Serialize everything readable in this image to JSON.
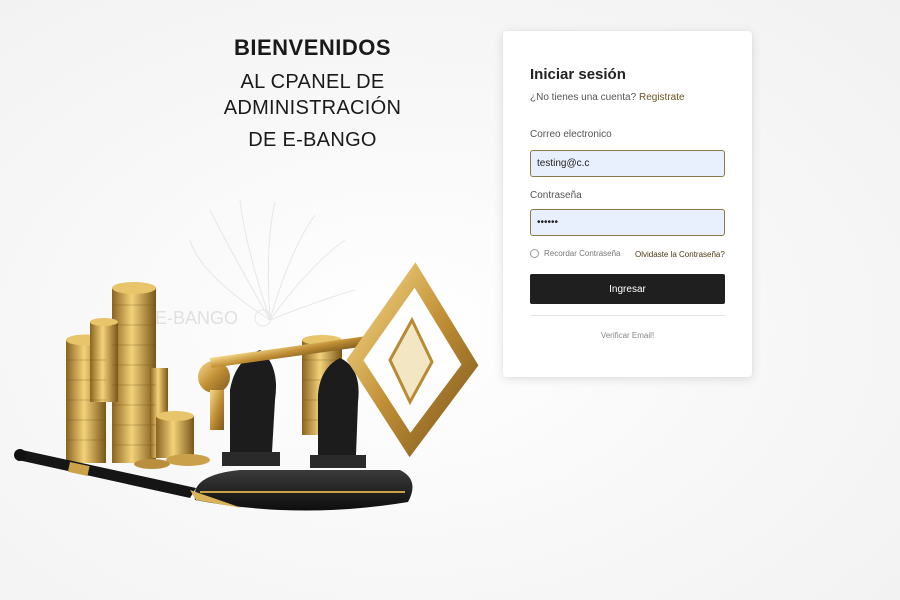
{
  "welcome": {
    "line1": "BIENVENIDOS",
    "line2": "AL CPANEL DE ADMINISTRACIÓN",
    "line3": "DE E-BANGO"
  },
  "illustration": {
    "watermark_text": "E-BANGO",
    "icons": [
      "gold-coins-icon",
      "fountain-pen-icon",
      "gold-key-icon",
      "chess-piece-icon"
    ]
  },
  "login": {
    "title": "Iniciar sesión",
    "no_account_text": "¿No tienes una cuenta?",
    "register_link": "Registrate",
    "email_label": "Correo electronico",
    "email_value": "testing@c.c",
    "password_label": "Contraseña",
    "password_value": "••••••",
    "remember_label": "Recordar Contraseña",
    "forgot_link": "Olvidaste la Contraseña?",
    "submit_label": "Ingresar",
    "verify_link": "Verificar Email!"
  },
  "colors": {
    "button_bg": "#1f1f1f",
    "input_bg": "#e8effd",
    "accent_gold": "#c9a24a",
    "link_color": "#6d5520"
  }
}
